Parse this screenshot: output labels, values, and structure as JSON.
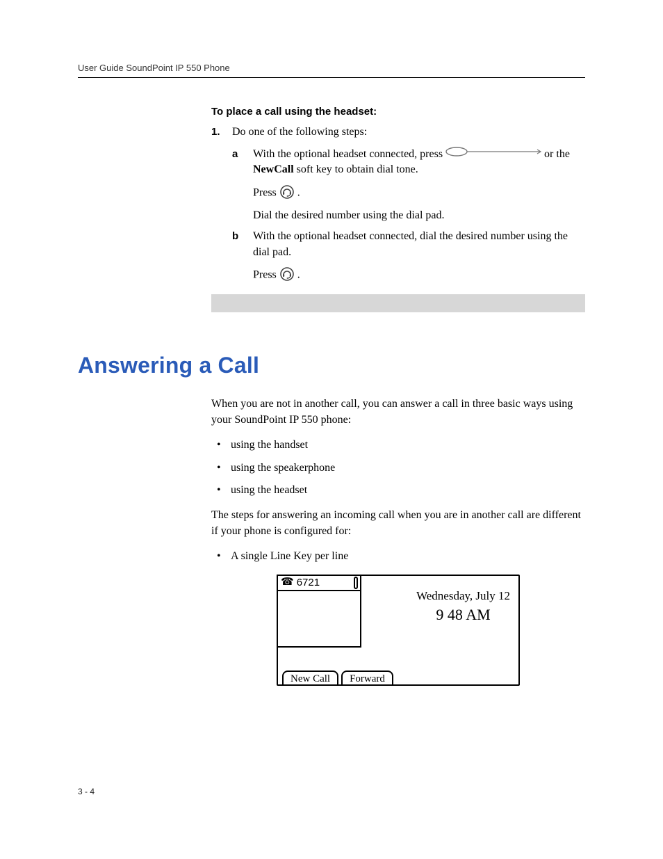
{
  "header": {
    "running": "User Guide SoundPoint IP 550 Phone"
  },
  "proc": {
    "heading": "To place a call using the headset:",
    "step1_num": "1.",
    "step1_text": "Do one of the following steps:",
    "a_letter": "a",
    "a_line1_pre": "With the optional headset connected, press ",
    "a_line1_post": " or the ",
    "a_bold": "NewCall",
    "a_line2": " soft key to obtain dial tone.",
    "a_press": "Press ",
    "a_period": " .",
    "a_dial": "Dial the desired number using the dial pad.",
    "b_letter": "b",
    "b_text": "With the optional headset connected, dial the desired number using the dial pad.",
    "b_press": "Press ",
    "b_period": " ."
  },
  "section": {
    "heading": "Answering a Call",
    "para1": "When you are not in another call, you can answer a call in three basic ways using your SoundPoint IP 550 phone:",
    "bullets": {
      "b1": "using the handset",
      "b2": "using the speakerphone",
      "b3": "using the headset"
    },
    "para2": "The steps for answering an incoming call when you are in another call are different if your phone is configured for:",
    "bullets2": {
      "b1": "A single Line Key per line"
    }
  },
  "display": {
    "line_number": "6721",
    "date": "Wednesday, July 12",
    "time": "9 48 AM",
    "softkeys": {
      "sk1": "New Call",
      "sk2": "Forward"
    }
  },
  "footer": {
    "pagenum": "3 - 4"
  }
}
